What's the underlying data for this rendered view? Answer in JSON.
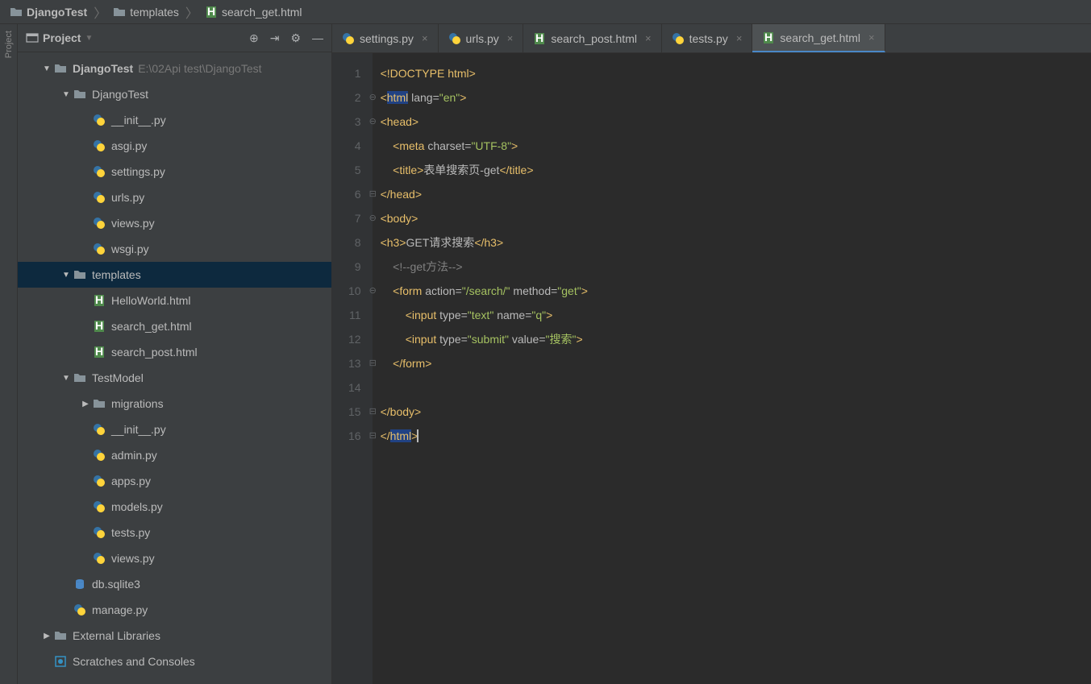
{
  "breadcrumb": [
    {
      "icon": "folder",
      "label": "DjangoTest",
      "bold": true
    },
    {
      "icon": "folder",
      "label": "templates"
    },
    {
      "icon": "html",
      "label": "search_get.html"
    }
  ],
  "sidebar": {
    "title": "Project",
    "toolbar_icons": [
      "target",
      "collapse",
      "gear",
      "hide"
    ]
  },
  "tree": [
    {
      "depth": 0,
      "arrow": "down",
      "icon": "folder",
      "label": "DjangoTest",
      "hint": "E:\\02Api test\\DjangoTest",
      "bold": true
    },
    {
      "depth": 1,
      "arrow": "down",
      "icon": "folder",
      "label": "DjangoTest"
    },
    {
      "depth": 2,
      "arrow": "",
      "icon": "py",
      "label": "__init__.py"
    },
    {
      "depth": 2,
      "arrow": "",
      "icon": "py",
      "label": "asgi.py"
    },
    {
      "depth": 2,
      "arrow": "",
      "icon": "py",
      "label": "settings.py"
    },
    {
      "depth": 2,
      "arrow": "",
      "icon": "py",
      "label": "urls.py"
    },
    {
      "depth": 2,
      "arrow": "",
      "icon": "py",
      "label": "views.py"
    },
    {
      "depth": 2,
      "arrow": "",
      "icon": "py",
      "label": "wsgi.py"
    },
    {
      "depth": 1,
      "arrow": "down",
      "icon": "folder",
      "label": "templates",
      "selected": true
    },
    {
      "depth": 2,
      "arrow": "",
      "icon": "html",
      "label": "HelloWorld.html"
    },
    {
      "depth": 2,
      "arrow": "",
      "icon": "html",
      "label": "search_get.html"
    },
    {
      "depth": 2,
      "arrow": "",
      "icon": "html",
      "label": "search_post.html"
    },
    {
      "depth": 1,
      "arrow": "down",
      "icon": "folder",
      "label": "TestModel"
    },
    {
      "depth": 2,
      "arrow": "right",
      "icon": "folder",
      "label": "migrations"
    },
    {
      "depth": 2,
      "arrow": "",
      "icon": "py",
      "label": "__init__.py"
    },
    {
      "depth": 2,
      "arrow": "",
      "icon": "py",
      "label": "admin.py"
    },
    {
      "depth": 2,
      "arrow": "",
      "icon": "py",
      "label": "apps.py"
    },
    {
      "depth": 2,
      "arrow": "",
      "icon": "py",
      "label": "models.py"
    },
    {
      "depth": 2,
      "arrow": "",
      "icon": "py",
      "label": "tests.py"
    },
    {
      "depth": 2,
      "arrow": "",
      "icon": "py",
      "label": "views.py"
    },
    {
      "depth": 1,
      "arrow": "",
      "icon": "db",
      "label": "db.sqlite3"
    },
    {
      "depth": 1,
      "arrow": "",
      "icon": "py",
      "label": "manage.py"
    },
    {
      "depth": 0,
      "arrow": "right",
      "icon": "lib",
      "label": "External Libraries"
    },
    {
      "depth": 0,
      "arrow": "",
      "icon": "scratch",
      "label": "Scratches and Consoles"
    }
  ],
  "tabs": [
    {
      "icon": "py",
      "label": "settings.py"
    },
    {
      "icon": "py",
      "label": "urls.py"
    },
    {
      "icon": "html",
      "label": "search_post.html"
    },
    {
      "icon": "py",
      "label": "tests.py"
    },
    {
      "icon": "html",
      "label": "search_get.html",
      "active": true
    }
  ],
  "code": {
    "lines": 16,
    "content": [
      {
        "n": 1,
        "html": "<span class='doctype'>&lt;!DOCTYPE html&gt;</span>"
      },
      {
        "n": 2,
        "fold": "⊖",
        "html": "<span class='tag-bracket'>&lt;</span><span class='tag-name hl-html'>html</span> <span class='attr-name'>lang=</span><span class='attr-val'>\"en\"</span><span class='tag-bracket'>&gt;</span>"
      },
      {
        "n": 3,
        "fold": "⊖",
        "html": "<span class='tag-bracket'>&lt;</span><span class='tag-name'>head</span><span class='tag-bracket'>&gt;</span>"
      },
      {
        "n": 4,
        "html": "    <span class='tag-bracket'>&lt;</span><span class='tag-name'>meta</span> <span class='attr-name'>charset=</span><span class='attr-val'>\"UTF-8\"</span><span class='tag-bracket'>&gt;</span>"
      },
      {
        "n": 5,
        "html": "    <span class='tag-bracket'>&lt;</span><span class='tag-name'>title</span><span class='tag-bracket'>&gt;</span><span class='text'>表单搜索页-get</span><span class='tag-bracket'>&lt;/</span><span class='tag-name'>title</span><span class='tag-bracket'>&gt;</span>"
      },
      {
        "n": 6,
        "fold": "⊟",
        "html": "<span class='tag-bracket'>&lt;/</span><span class='tag-name'>head</span><span class='tag-bracket'>&gt;</span>"
      },
      {
        "n": 7,
        "fold": "⊖",
        "html": "<span class='tag-bracket'>&lt;</span><span class='tag-name'>body</span><span class='tag-bracket'>&gt;</span>"
      },
      {
        "n": 8,
        "html": "<span class='tag-bracket'>&lt;</span><span class='tag-name'>h3</span><span class='tag-bracket'>&gt;</span><span class='text'>GET请求搜索</span><span class='tag-bracket'>&lt;/</span><span class='tag-name'>h3</span><span class='tag-bracket'>&gt;</span>"
      },
      {
        "n": 9,
        "html": "    <span class='comment'>&lt;!--get方法--&gt;</span>"
      },
      {
        "n": 10,
        "fold": "⊖",
        "html": "    <span class='tag-bracket'>&lt;</span><span class='tag-name'>form</span> <span class='attr-name'>action=</span><span class='attr-val'>\"/search/\"</span> <span class='attr-name'>method=</span><span class='attr-val'>\"get\"</span><span class='tag-bracket'>&gt;</span>"
      },
      {
        "n": 11,
        "html": "        <span class='tag-bracket'>&lt;</span><span class='tag-name'>input</span> <span class='attr-name'>type=</span><span class='attr-val'>\"text\"</span> <span class='attr-name'>name=</span><span class='attr-val'>\"q\"</span><span class='tag-bracket'>&gt;</span>"
      },
      {
        "n": 12,
        "html": "        <span class='tag-bracket'>&lt;</span><span class='tag-name'>input</span> <span class='attr-name'>type=</span><span class='attr-val'>\"submit\"</span> <span class='attr-name'>value=</span><span class='attr-val'>\"搜索\"</span><span class='tag-bracket'>&gt;</span>"
      },
      {
        "n": 13,
        "fold": "⊟",
        "html": "    <span class='tag-bracket'>&lt;/</span><span class='tag-name'>form</span><span class='tag-bracket'>&gt;</span>"
      },
      {
        "n": 14,
        "html": ""
      },
      {
        "n": 15,
        "fold": "⊟",
        "html": "<span class='tag-bracket'>&lt;/</span><span class='tag-name'>body</span><span class='tag-bracket'>&gt;</span>"
      },
      {
        "n": 16,
        "fold": "⊟",
        "html": "<span class='tag-bracket'>&lt;/</span><span class='tag-name hl-html'>html</span><span class='tag-bracket'>&gt;</span><span class='cursor'></span>"
      }
    ]
  }
}
